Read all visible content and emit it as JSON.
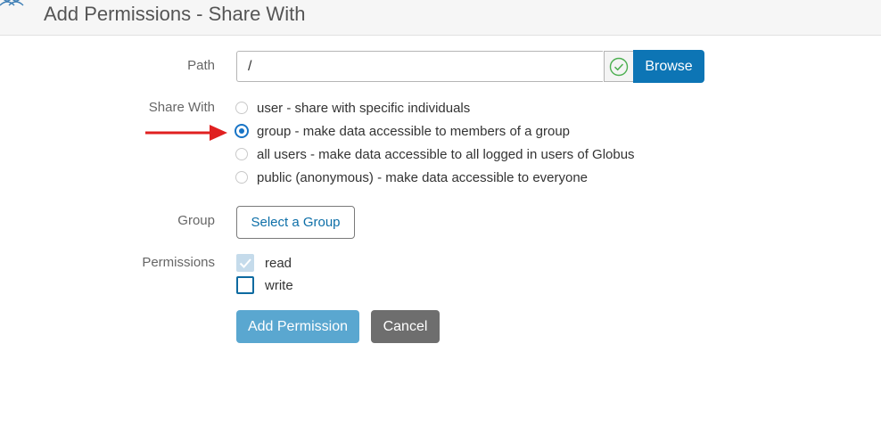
{
  "header": {
    "title": "Add Permissions - Share With",
    "icon": "users-icon"
  },
  "form": {
    "path": {
      "label": "Path",
      "value": "/",
      "valid_icon": "check-circle-icon",
      "browse_label": "Browse"
    },
    "share_with": {
      "label": "Share With",
      "options": [
        {
          "label": "user - share with specific individuals",
          "checked": false
        },
        {
          "label": "group - make data accessible to members of a group",
          "checked": true
        },
        {
          "label": "all users - make data accessible to all logged in users of Globus",
          "checked": false
        },
        {
          "label": "public (anonymous) - make data accessible to everyone",
          "checked": false
        }
      ]
    },
    "group": {
      "label": "Group",
      "button_label": "Select a Group"
    },
    "permissions": {
      "label": "Permissions",
      "options": [
        {
          "label": "read",
          "checked": true,
          "disabled": true
        },
        {
          "label": "write",
          "checked": false,
          "disabled": false
        }
      ]
    },
    "actions": {
      "add_label": "Add Permission",
      "cancel_label": "Cancel"
    }
  },
  "colors": {
    "primary": "#0d75b5",
    "primary_light": "#5aa7d0",
    "cancel": "#6e6e6e",
    "valid_check": "#4caf50",
    "annotation_arrow": "#e02020"
  }
}
